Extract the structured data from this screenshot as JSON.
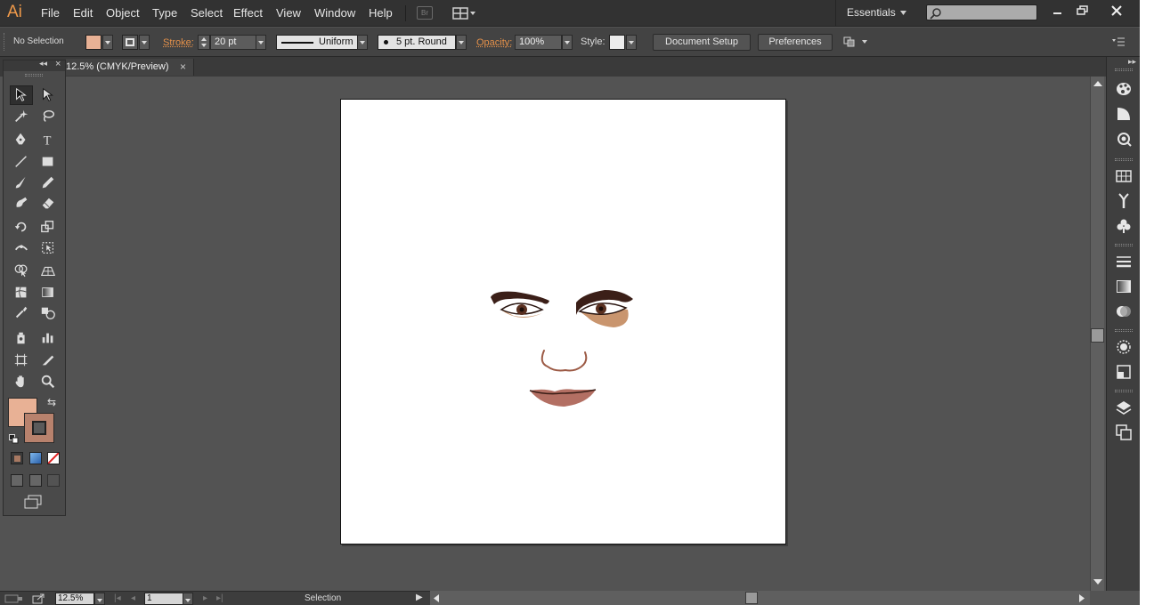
{
  "app": {
    "logo": "Ai"
  },
  "menu": [
    "File",
    "Edit",
    "Object",
    "Type",
    "Select",
    "Effect",
    "View",
    "Window",
    "Help"
  ],
  "bridge_label": "Br",
  "workspace": "Essentials",
  "control": {
    "selection_label": "No Selection",
    "fill_color": "#e8b195",
    "stroke_label": "Stroke:",
    "stroke_weight": "20 pt",
    "profile": "Uniform",
    "brush": "5 pt. Round",
    "opacity_label": "Opacity:",
    "opacity": "100%",
    "style_label": "Style:",
    "document_setup": "Document Setup",
    "preferences": "Preferences"
  },
  "document": {
    "tab_title": "12.5% (CMYK/Preview)"
  },
  "tools": {
    "fill_color": "#e8b195",
    "stroke_color": "#b8826d",
    "icons": [
      "selection-tool",
      "direct-selection-tool",
      "magic-wand-tool",
      "lasso-tool",
      "pen-tool",
      "type-tool",
      "line-segment-tool",
      "rectangle-tool",
      "paintbrush-tool",
      "pencil-tool",
      "blob-brush-tool",
      "eraser-tool",
      "rotate-tool",
      "scale-tool",
      "width-tool",
      "free-transform-tool",
      "shape-builder-tool",
      "perspective-grid-tool",
      "mesh-tool",
      "gradient-tool",
      "eyedropper-tool",
      "blend-tool",
      "symbol-sprayer-tool",
      "column-graph-tool",
      "artboard-tool",
      "slice-tool",
      "hand-tool",
      "zoom-tool"
    ]
  },
  "statusbar": {
    "zoom": "12.5%",
    "artboard": "1",
    "tool_status": "Selection"
  },
  "artwork": {
    "eyebrow_color": "#3b1f18",
    "eye_shadow_color": "#c9956e",
    "iris_color": "#5a3020",
    "nose_color": "#9c5a45",
    "lip_color": "#b36f63",
    "lip_line_color": "#3a1e17"
  }
}
